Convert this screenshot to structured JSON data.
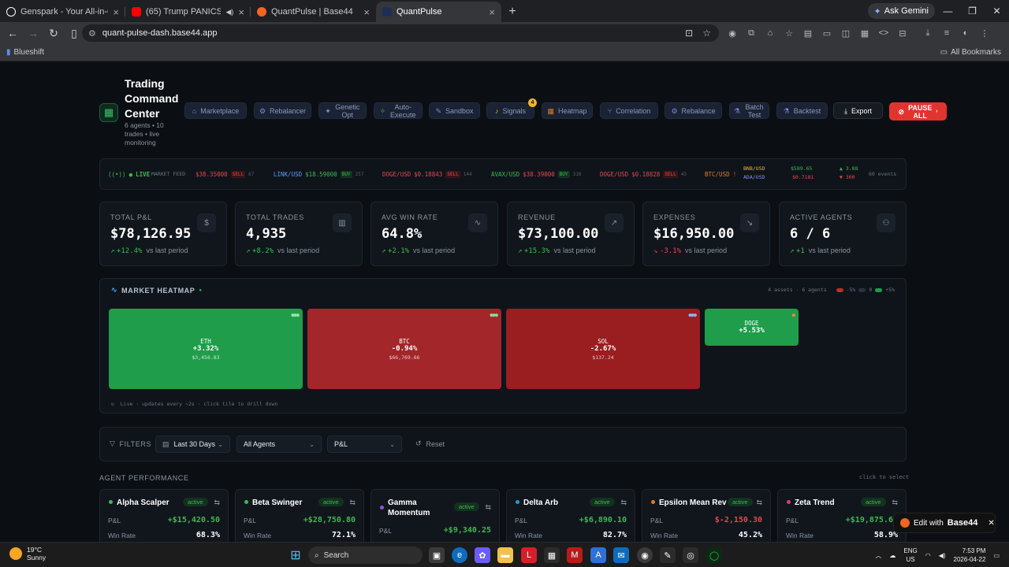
{
  "browser": {
    "tabs": [
      {
        "title": "Genspark - Your All-in-One AI W",
        "color": "#ffffff"
      },
      {
        "title": "(65) Trump PANICS as Gene",
        "color": "#ff0000"
      },
      {
        "title": "QuantPulse | Base44",
        "color": "#f26522"
      },
      {
        "title": "QuantPulse",
        "color": "#1f6feb"
      }
    ],
    "ask_gemini": "Ask Gemini",
    "url": "quant-pulse-dash.base44.app",
    "bookmark": "Blueshift",
    "all_bookmarks": "All Bookmarks"
  },
  "header": {
    "title": "Trading Command Center",
    "subtitle": "6 agents • 10 trades • live monitoring",
    "buttons": [
      {
        "label": "Marketplace",
        "icon": "store-icon"
      },
      {
        "label": "Rebalancer",
        "icon": "gear-icon"
      },
      {
        "label": "Genetic Opt",
        "icon": "sparkle-icon"
      },
      {
        "label": "Auto-Execute",
        "icon": "zap-icon"
      },
      {
        "label": "Sandbox",
        "icon": "pen-icon"
      },
      {
        "label": "Signals",
        "icon": "bell-icon",
        "badge": "4"
      },
      {
        "label": "Heatmap",
        "icon": "grid-icon"
      },
      {
        "label": "Correlation",
        "icon": "branch-icon"
      },
      {
        "label": "Rebalance",
        "icon": "gear-icon"
      },
      {
        "label": "Batch Test",
        "icon": "flask-icon"
      },
      {
        "label": "Backtest",
        "icon": "flask-icon"
      }
    ],
    "export": "Export",
    "pause": "PAUSE ALL"
  },
  "ticker": {
    "live": "LIVE",
    "feed_label": "MARKET FEED",
    "items": [
      {
        "pair": "",
        "price": "$38.35000",
        "side": "SELL",
        "count": "67"
      },
      {
        "pair": "LINK/USD",
        "price": "$18.59000",
        "side": "BUY",
        "count": "257"
      },
      {
        "pair": "DOGE/USD",
        "price": "$0.18843",
        "side": "SELL",
        "count": "144"
      },
      {
        "pair": "AVAX/USD",
        "price": "$38.39000",
        "side": "BUY",
        "count": "318"
      },
      {
        "pair": "DOGE/USD",
        "price": "$0.18828",
        "side": "SELL",
        "count": "43"
      }
    ],
    "btc": "BTC/USD",
    "bnb": {
      "pair": "BNB/USD",
      "price": "$589.65",
      "chg": "▲ 3.88"
    },
    "ada": {
      "pair": "ADA/USD",
      "price": "$0.7181",
      "chg": "▼ 300"
    },
    "events": "60 events"
  },
  "kpis": [
    {
      "label": "TOTAL P&L",
      "value": "$78,126.95",
      "change": "+12.4%",
      "dir": "up",
      "suffix": "vs last period",
      "icon": "dollar-icon"
    },
    {
      "label": "TOTAL TRADES",
      "value": "4,935",
      "change": "+8.2%",
      "dir": "up",
      "suffix": "vs last period",
      "icon": "bar-chart-icon"
    },
    {
      "label": "AVG WIN RATE",
      "value": "64.8%",
      "change": "+2.1%",
      "dir": "up",
      "suffix": "vs last period",
      "icon": "activity-icon"
    },
    {
      "label": "REVENUE",
      "value": "$73,100.00",
      "change": "+15.3%",
      "dir": "up",
      "suffix": "vs last period",
      "icon": "trending-up-icon"
    },
    {
      "label": "EXPENSES",
      "value": "$16,950.00",
      "change": "-3.1%",
      "dir": "down",
      "suffix": "vs last period",
      "icon": "trending-down-icon"
    },
    {
      "label": "ACTIVE AGENTS",
      "value": "6 / 6",
      "change": "+1",
      "dir": "up",
      "suffix": "vs last period",
      "icon": "users-icon"
    }
  ],
  "heatmap": {
    "title": "MARKET HEATMAP",
    "meta": "4 assets · 6 agents",
    "legend_neg": "-5%",
    "legend_zero": "0",
    "legend_pos": "+5%",
    "tiles": [
      {
        "sym": "ETH",
        "pct": "+3.32%",
        "price": "$3,456.83",
        "color": "#1f9d4a"
      },
      {
        "sym": "BTC",
        "pct": "-0.94%",
        "price": "$66,769.66",
        "color": "#a3262a"
      },
      {
        "sym": "SOL",
        "pct": "-2.67%",
        "price": "$137.24",
        "color": "#9a1d20"
      },
      {
        "sym": "DOGE",
        "pct": "+5.53%",
        "price": "",
        "color": "#1f9d4a"
      }
    ],
    "footer": "Live · updates every ~2s · click tile to drill down"
  },
  "filters": {
    "label": "FILTERS",
    "range": "Last 30 Days",
    "agents": "All Agents",
    "metric": "P&L",
    "reset": "Reset"
  },
  "agents_section": {
    "title": "AGENT PERFORMANCE",
    "hint": "click to select",
    "agents": [
      {
        "name": "Alpha Scalper",
        "status": "active",
        "pnl": "+$15,420.50",
        "win": "68.3%",
        "dot": "#3fb950",
        "neg": false
      },
      {
        "name": "Beta Swinger",
        "status": "active",
        "pnl": "+$28,750.80",
        "win": "72.1%",
        "dot": "#3fb950",
        "neg": false
      },
      {
        "name": "Gamma Momentum",
        "status": "active",
        "pnl": "+$9,340.25",
        "win": "",
        "dot": "#8957e5",
        "neg": false
      },
      {
        "name": "Delta Arb",
        "status": "active",
        "pnl": "+$6,890.10",
        "win": "82.7%",
        "dot": "#1f9bd8",
        "neg": false
      },
      {
        "name": "Epsilon Mean Rev",
        "status": "active",
        "pnl": "$-2,150.30",
        "win": "45.2%",
        "dot": "#e07b2a",
        "neg": true
      },
      {
        "name": "Zeta Trend",
        "status": "active",
        "pnl": "+$19,875.60",
        "win": "58.9%",
        "dot": "#db3d6d",
        "neg": false
      }
    ],
    "pnl_label": "P&L",
    "win_label": "Win Rate"
  },
  "edit_base44": {
    "prefix": "Edit with",
    "brand": "Base44"
  },
  "taskbar": {
    "temp": "19°C",
    "weather": "Sunny",
    "search": "Search",
    "lang1": "ENG",
    "lang2": "US",
    "time": "7:53 PM",
    "date": "2026-04-22"
  }
}
